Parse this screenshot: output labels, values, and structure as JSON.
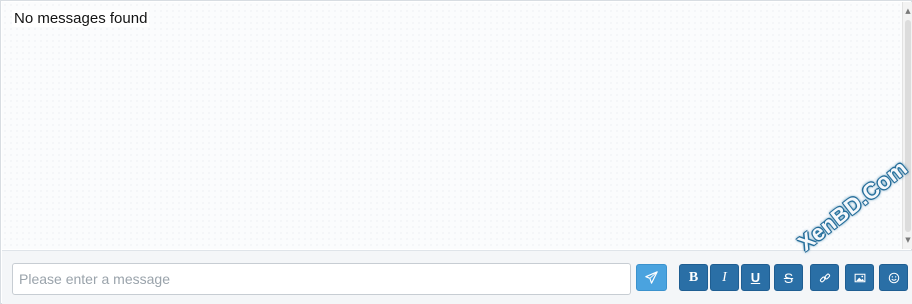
{
  "messages": {
    "empty_text": "No messages found"
  },
  "composer": {
    "placeholder": "Please enter a message",
    "value": "",
    "send_icon": "paper-plane-icon",
    "buttons": [
      {
        "label": "B",
        "name": "bold"
      },
      {
        "label": "I",
        "name": "italic"
      },
      {
        "label": "U",
        "name": "underline"
      },
      {
        "label": "S",
        "name": "strikethrough"
      },
      {
        "label": "",
        "name": "link",
        "icon": "link-icon"
      },
      {
        "label": "",
        "name": "image",
        "icon": "image-icon"
      },
      {
        "label": "",
        "name": "emoji",
        "icon": "smiley-icon"
      }
    ]
  },
  "watermark": {
    "text": "XenBD.Com"
  },
  "colors": {
    "send_button": "#4aa3df",
    "format_button": "#2a6fa6",
    "watermark_outline": "#2c79a4"
  }
}
